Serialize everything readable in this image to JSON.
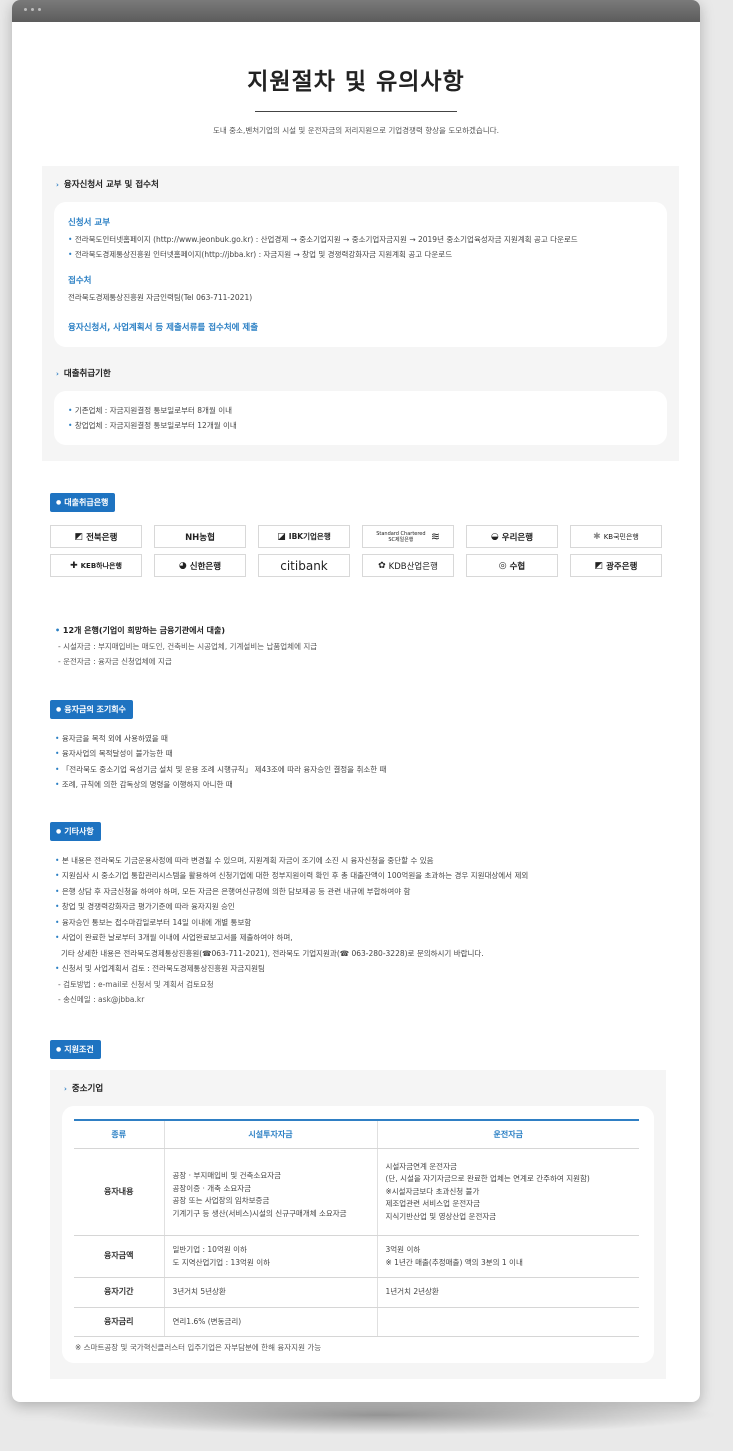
{
  "page": {
    "title": "지원절차 및 유의사항",
    "subtitle": "도내 중소,벤처기업의 시설 및 운전자금의 저리지원으로 기업경쟁력 향상을 도모하겠습니다."
  },
  "section1": {
    "heading": "융자신청서 교부 및 접수처",
    "form_label": "신청서 교부",
    "form_lines": [
      "전라북도인터넷홈페이지 (http://www.jeonbuk.go.kr) : 산업경제 → 중소기업지원 → 중소기업자금지원 → 2019년 중소기업육성자금 지원계획 공고 다운로드",
      "전라북도경제통상진흥원 인터넷홈페이지(http://jbba.kr) : 자금지원 → 창업 및 경쟁력강화자금 지원계획 공고 다운로드"
    ],
    "office_label": "접수처",
    "office_text": "전라북도경제통상진흥원 자금인력팀(Tel 063-711-2021)",
    "submit_note": "융자신청서, 사업계획서 등 제출서류를 접수처에 제출"
  },
  "section2": {
    "heading": "대출취급기한",
    "lines": [
      "기존업체 : 자금지원결정 통보일로부터 8개월 이내",
      "창업업체 : 자금지원결정 통보일로부터 12개월 이내"
    ]
  },
  "banks": {
    "badge": "대출취급은행",
    "items": [
      {
        "name": "전북은행",
        "icon": "jb-bank-logo"
      },
      {
        "name": "NH농협",
        "icon": "nh-bank-logo"
      },
      {
        "name": "IBK기업은행",
        "icon": "ibk-bank-logo"
      },
      {
        "name": "Standard Chartered SC제일은행",
        "icon": "sc-bank-logo"
      },
      {
        "name": "우리은행",
        "icon": "woori-bank-logo"
      },
      {
        "name": "KB국민은행",
        "icon": "kb-bank-logo"
      },
      {
        "name": "KEB하나은행",
        "icon": "keb-hana-logo"
      },
      {
        "name": "신한은행",
        "icon": "shinhan-logo"
      },
      {
        "name": "citibank",
        "icon": "citi-logo"
      },
      {
        "name": "KDB산업은행",
        "icon": "kdb-logo"
      },
      {
        "name": "수협",
        "icon": "suhyup-logo"
      },
      {
        "name": "광주은행",
        "icon": "kwangju-logo"
      }
    ],
    "colors": [
      "#1a1a1a",
      "#1a1a1a",
      "#1a1a1a",
      "#1a1a1a",
      "#1a1a1a",
      "#1a1a1a",
      "#1a1a1a",
      "#1a1a1a",
      "#1a1a1a",
      "#1a1a1a",
      "#1a1a1a",
      "#1a1a1a"
    ],
    "heading": "12개 은행(기업이 희망하는 금융기관에서 대출)",
    "sub_lines": [
      "- 시설자금 : 부지매입비는 매도인, 건축비는 시공업체, 기계설비는 납품업체에 지급",
      "- 운전자금 : 융자금 신청업체에 지급"
    ]
  },
  "early": {
    "badge": "융자금의 조기회수",
    "lines": [
      "융자금을 목적 외에 사용하였을 때",
      "융자사업의 목적달성이 불가능한 때",
      "「전라북도 중소기업 육성기금 설치 및 운용 조례 시행규칙」 제43조에 따라 융자승인 결정을 취소한 때",
      "조례, 규칙에 의한 감독상의 명령을 이행하지 아니한 때"
    ]
  },
  "etc": {
    "badge": "기타사항",
    "lines": [
      {
        "bullet": true,
        "text": "본 내용은 전라북도 기금운용사정에 따라 변경될 수 있으며, 지원계획 자금이 조기에 소진 시 융자신청을 중단할 수 있음"
      },
      {
        "bullet": true,
        "text": "지원심사 시 중소기업 통합관리시스템을 활용하여 신청기업에 대한 정부지원이력 확인 후 총 대출잔액이 100억원을 초과하는 경우 지원대상에서 제외"
      },
      {
        "bullet": true,
        "text": "은행 상담 후 자금신청을 하여야 하며, 모든 자금은 은행여신규정에 의한 담보제공 등 관련 내규에 부합하여야 함"
      },
      {
        "bullet": true,
        "text": "창업 및 경쟁력강화자금 평가기준에 따라 융자지원 승인"
      },
      {
        "bullet": true,
        "text": "융자승인 통보는 접수마감일로부터 14일 이내에 개별 통보함"
      },
      {
        "bullet": true,
        "text": "사업이 완료한 날로부터 3개월 이내에 사업완료보고서를 제출하여야 하며,"
      },
      {
        "bullet": false,
        "text": "기타 상세한 내용은 전라북도경제통상진흥원(☎063-711-2021), 전라북도 기업지원과(☎ 063-280-3228)로 문의하시기 바랍니다."
      },
      {
        "bullet": true,
        "text": "신청서 및 사업계획서 검토 : 전라북도경제통상진흥원 자금지원팀"
      },
      {
        "bullet": false,
        "text": "- 검토방법 : e-mail로 신청서 및 계획서 검토요청"
      },
      {
        "bullet": false,
        "text": "- 송신메일 : ask@jbba.kr"
      }
    ]
  },
  "support": {
    "badge": "지원조건",
    "heading": "중소기업",
    "table": {
      "headers": [
        "종류",
        "시설투자자금",
        "운전자금"
      ],
      "rows": [
        {
          "label": "융자내용",
          "c2": [
            "공장 · 부지매입비 및 건축소요자금",
            "공장이증 · 개축 소요자금",
            "공장 또는 사업장의 임차보증금",
            "기계기구 등 생산(서비스)시설의 신규구매개체 소요자금"
          ],
          "c3": [
            "시설자금연계 운전자금",
            "(단, 시설을 자기자금으로 완료한 업체는 연계로 간주하여 지원함)",
            "※시설자금보다 초과신청 불가",
            "제조업관련 서비스업 운전자금",
            "지식기반산업 및 영상산업 운전자금"
          ]
        },
        {
          "label": "융자금액",
          "c2": [
            "일반기업 : 10억원 이하",
            "도 지역산업기업 : 13억원 이하"
          ],
          "c3": [
            "3억원 이하",
            "※ 1년간 매출(추정매출) 액의 3분의 1 이내"
          ]
        },
        {
          "label": "융자기간",
          "c2": [
            "3년거치 5년상환"
          ],
          "c3": [
            "1년거치 2년상환"
          ]
        },
        {
          "label": "융자금리",
          "c2": [
            "연리1.6% (변동금리)"
          ],
          "c3": []
        }
      ]
    },
    "footnote": "※ 스마트공장 및 국가혁신클러스터 입주기업은 자부담분에 한해 융자지원 가능"
  }
}
